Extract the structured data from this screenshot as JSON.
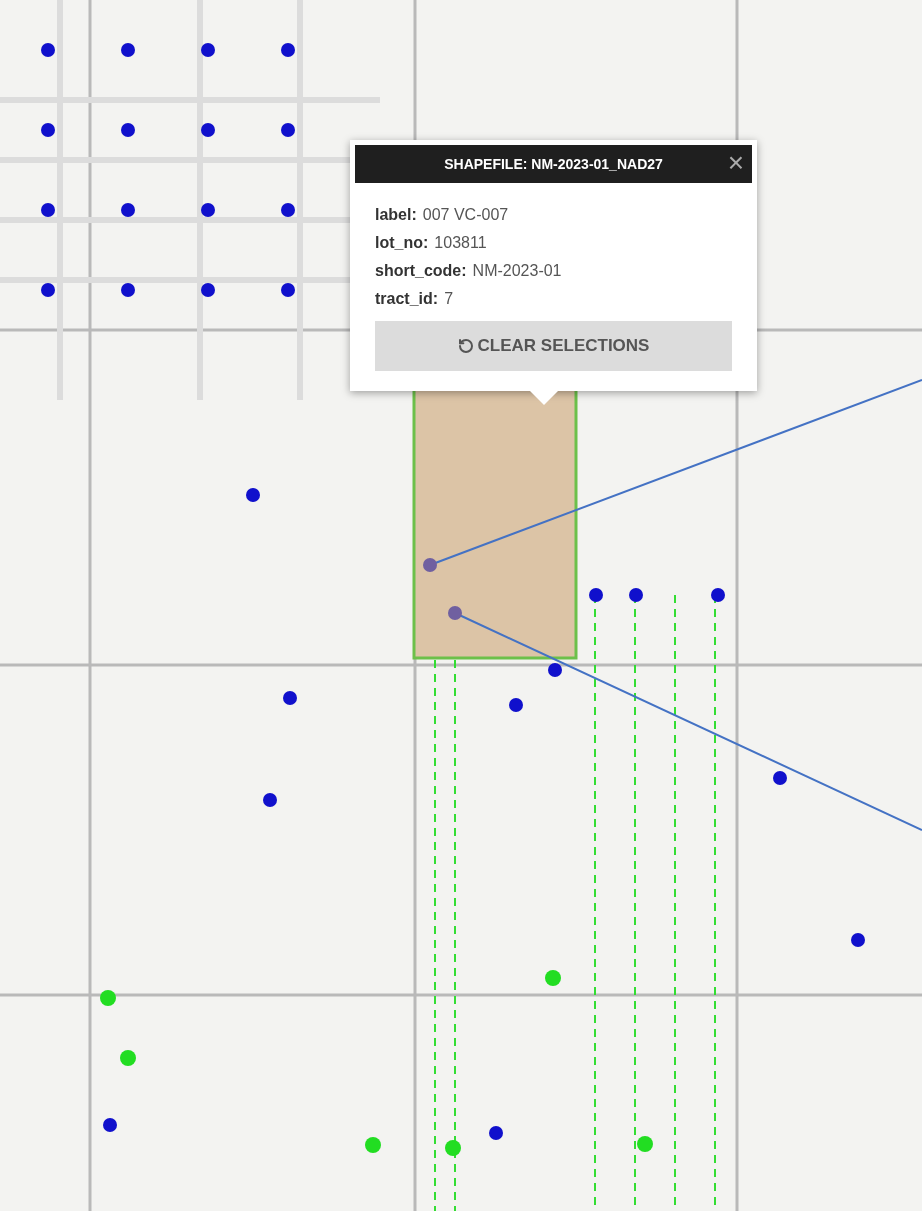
{
  "popup": {
    "title": "SHAPEFILE: NM-2023-01_NAD27",
    "close": "×",
    "fields": [
      {
        "key": "label:",
        "value": "007 VC-007"
      },
      {
        "key": "lot_no:",
        "value": "103811"
      },
      {
        "key": "short_code:",
        "value": "NM-2023-01"
      },
      {
        "key": "tract_id:",
        "value": "7"
      }
    ],
    "button": "CLEAR SELECTIONS"
  }
}
